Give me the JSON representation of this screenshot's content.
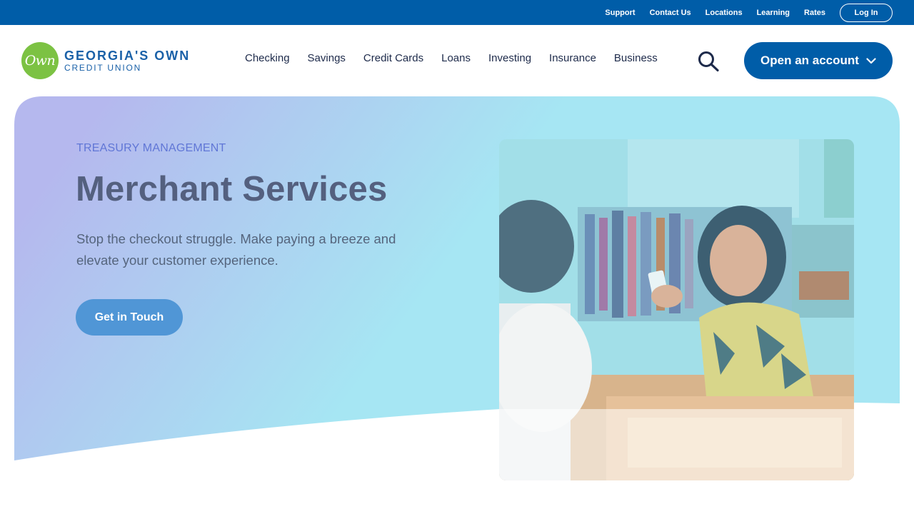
{
  "utility_nav": {
    "links": [
      "Support",
      "Contact Us",
      "Locations",
      "Learning",
      "Rates"
    ],
    "login_label": "Log In"
  },
  "brand": {
    "logo_mark": "Own",
    "name_line1": "GEORGIA'S OWN",
    "name_line2": "CREDIT UNION",
    "primary_color": "#005da8",
    "logo_color": "#7cc243"
  },
  "main_nav": {
    "items": [
      "Checking",
      "Savings",
      "Credit Cards",
      "Loans",
      "Investing",
      "Insurance",
      "Business"
    ],
    "search_icon": "search-icon",
    "open_account_label": "Open an account",
    "open_account_icon": "chevron-down-icon"
  },
  "hero": {
    "eyebrow": "TREASURY MANAGEMENT",
    "title": "Merchant Services",
    "subtitle": "Stop the checkout struggle. Make paying a breeze and elevate your customer experience.",
    "cta_label": "Get in Touch",
    "gradient_start": "#b5b8ee",
    "gradient_end": "#a6e6f3"
  }
}
